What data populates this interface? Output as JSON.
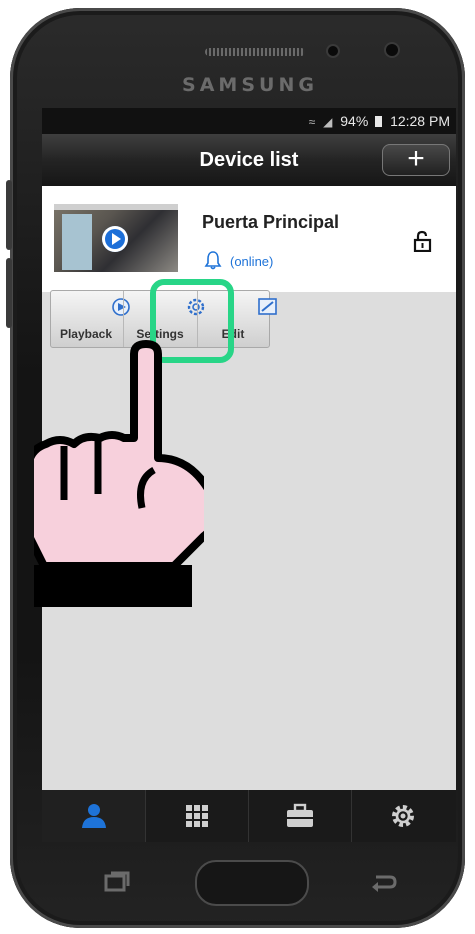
{
  "phone": {
    "brand": "SAMSUNG"
  },
  "status_bar": {
    "battery": "94%",
    "time": "12:28 PM"
  },
  "header": {
    "title": "Device list",
    "add_button": "+"
  },
  "device": {
    "name": "Puerta Principal",
    "status": "(online)"
  },
  "actions": {
    "playback": "Playback",
    "settings": "Settings",
    "edit": "Edit"
  },
  "tabs": [
    {
      "icon": "person-icon",
      "active": true
    },
    {
      "icon": "grid-icon",
      "active": false
    },
    {
      "icon": "briefcase-icon",
      "active": false
    },
    {
      "icon": "gear-icon",
      "active": false
    }
  ],
  "colors": {
    "accent_blue": "#1e73d8",
    "highlight_green": "#28d587",
    "hand_fill": "#f7d0dc"
  }
}
